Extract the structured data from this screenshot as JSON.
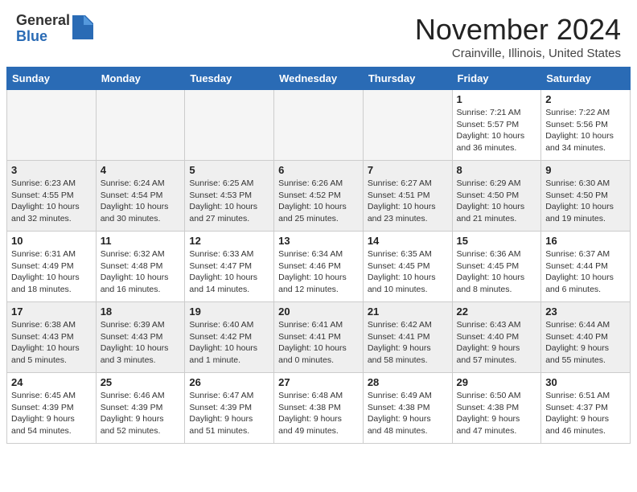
{
  "header": {
    "logo_line1": "General",
    "logo_line2": "Blue",
    "month_title": "November 2024",
    "location": "Crainville, Illinois, United States"
  },
  "days_of_week": [
    "Sunday",
    "Monday",
    "Tuesday",
    "Wednesday",
    "Thursday",
    "Friday",
    "Saturday"
  ],
  "weeks": [
    [
      {
        "day": "",
        "info": "",
        "empty": true
      },
      {
        "day": "",
        "info": "",
        "empty": true
      },
      {
        "day": "",
        "info": "",
        "empty": true
      },
      {
        "day": "",
        "info": "",
        "empty": true
      },
      {
        "day": "",
        "info": "",
        "empty": true
      },
      {
        "day": "1",
        "info": "Sunrise: 7:21 AM\nSunset: 5:57 PM\nDaylight: 10 hours\nand 36 minutes."
      },
      {
        "day": "2",
        "info": "Sunrise: 7:22 AM\nSunset: 5:56 PM\nDaylight: 10 hours\nand 34 minutes."
      }
    ],
    [
      {
        "day": "3",
        "info": "Sunrise: 6:23 AM\nSunset: 4:55 PM\nDaylight: 10 hours\nand 32 minutes."
      },
      {
        "day": "4",
        "info": "Sunrise: 6:24 AM\nSunset: 4:54 PM\nDaylight: 10 hours\nand 30 minutes."
      },
      {
        "day": "5",
        "info": "Sunrise: 6:25 AM\nSunset: 4:53 PM\nDaylight: 10 hours\nand 27 minutes."
      },
      {
        "day": "6",
        "info": "Sunrise: 6:26 AM\nSunset: 4:52 PM\nDaylight: 10 hours\nand 25 minutes."
      },
      {
        "day": "7",
        "info": "Sunrise: 6:27 AM\nSunset: 4:51 PM\nDaylight: 10 hours\nand 23 minutes."
      },
      {
        "day": "8",
        "info": "Sunrise: 6:29 AM\nSunset: 4:50 PM\nDaylight: 10 hours\nand 21 minutes."
      },
      {
        "day": "9",
        "info": "Sunrise: 6:30 AM\nSunset: 4:50 PM\nDaylight: 10 hours\nand 19 minutes."
      }
    ],
    [
      {
        "day": "10",
        "info": "Sunrise: 6:31 AM\nSunset: 4:49 PM\nDaylight: 10 hours\nand 18 minutes."
      },
      {
        "day": "11",
        "info": "Sunrise: 6:32 AM\nSunset: 4:48 PM\nDaylight: 10 hours\nand 16 minutes."
      },
      {
        "day": "12",
        "info": "Sunrise: 6:33 AM\nSunset: 4:47 PM\nDaylight: 10 hours\nand 14 minutes."
      },
      {
        "day": "13",
        "info": "Sunrise: 6:34 AM\nSunset: 4:46 PM\nDaylight: 10 hours\nand 12 minutes."
      },
      {
        "day": "14",
        "info": "Sunrise: 6:35 AM\nSunset: 4:45 PM\nDaylight: 10 hours\nand 10 minutes."
      },
      {
        "day": "15",
        "info": "Sunrise: 6:36 AM\nSunset: 4:45 PM\nDaylight: 10 hours\nand 8 minutes."
      },
      {
        "day": "16",
        "info": "Sunrise: 6:37 AM\nSunset: 4:44 PM\nDaylight: 10 hours\nand 6 minutes."
      }
    ],
    [
      {
        "day": "17",
        "info": "Sunrise: 6:38 AM\nSunset: 4:43 PM\nDaylight: 10 hours\nand 5 minutes."
      },
      {
        "day": "18",
        "info": "Sunrise: 6:39 AM\nSunset: 4:43 PM\nDaylight: 10 hours\nand 3 minutes."
      },
      {
        "day": "19",
        "info": "Sunrise: 6:40 AM\nSunset: 4:42 PM\nDaylight: 10 hours\nand 1 minute."
      },
      {
        "day": "20",
        "info": "Sunrise: 6:41 AM\nSunset: 4:41 PM\nDaylight: 10 hours\nand 0 minutes."
      },
      {
        "day": "21",
        "info": "Sunrise: 6:42 AM\nSunset: 4:41 PM\nDaylight: 9 hours\nand 58 minutes."
      },
      {
        "day": "22",
        "info": "Sunrise: 6:43 AM\nSunset: 4:40 PM\nDaylight: 9 hours\nand 57 minutes."
      },
      {
        "day": "23",
        "info": "Sunrise: 6:44 AM\nSunset: 4:40 PM\nDaylight: 9 hours\nand 55 minutes."
      }
    ],
    [
      {
        "day": "24",
        "info": "Sunrise: 6:45 AM\nSunset: 4:39 PM\nDaylight: 9 hours\nand 54 minutes."
      },
      {
        "day": "25",
        "info": "Sunrise: 6:46 AM\nSunset: 4:39 PM\nDaylight: 9 hours\nand 52 minutes."
      },
      {
        "day": "26",
        "info": "Sunrise: 6:47 AM\nSunset: 4:39 PM\nDaylight: 9 hours\nand 51 minutes."
      },
      {
        "day": "27",
        "info": "Sunrise: 6:48 AM\nSunset: 4:38 PM\nDaylight: 9 hours\nand 49 minutes."
      },
      {
        "day": "28",
        "info": "Sunrise: 6:49 AM\nSunset: 4:38 PM\nDaylight: 9 hours\nand 48 minutes."
      },
      {
        "day": "29",
        "info": "Sunrise: 6:50 AM\nSunset: 4:38 PM\nDaylight: 9 hours\nand 47 minutes."
      },
      {
        "day": "30",
        "info": "Sunrise: 6:51 AM\nSunset: 4:37 PM\nDaylight: 9 hours\nand 46 minutes."
      }
    ]
  ]
}
